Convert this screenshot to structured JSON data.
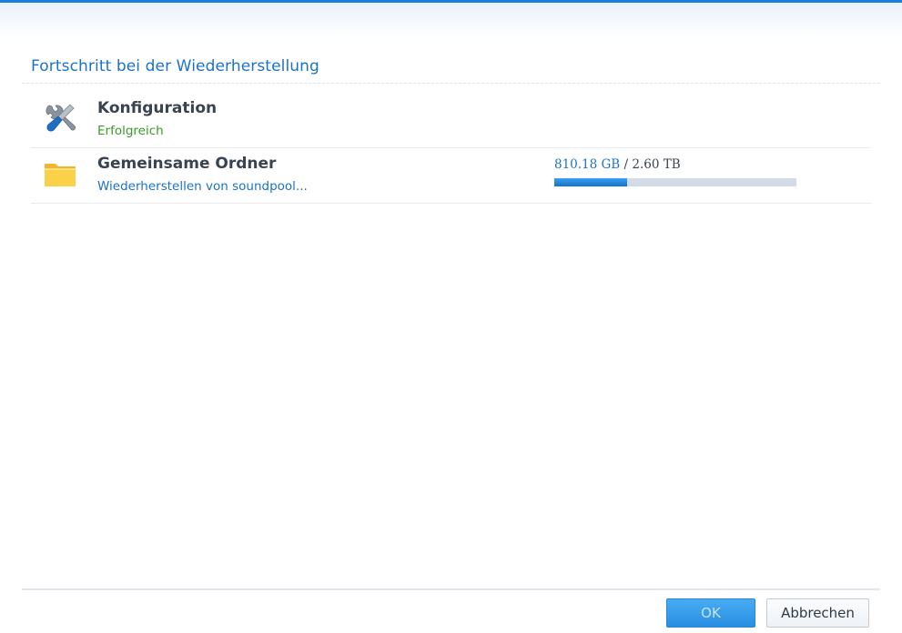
{
  "dialog": {
    "title": "Fortschritt bei der Wiederherstellung"
  },
  "tasks": [
    {
      "name": "Konfiguration",
      "status": "Erfolgreich",
      "icon": "tools-icon"
    },
    {
      "name": "Gemeinsame Ordner",
      "status": "Wiederherstellen von soundpool...",
      "icon": "folder-icon",
      "restored": "810.18 GB",
      "separator": "/",
      "total": "2.60 TB",
      "progress_fraction": 0.3
    }
  ],
  "buttons": {
    "ok_label": "OK",
    "cancel_label": "Abbrechen"
  },
  "colors": {
    "accent": "#1a73c9",
    "success": "#3a9a2a",
    "progress_fill": "#2a8fe3",
    "progress_track": "#d3dce6"
  }
}
